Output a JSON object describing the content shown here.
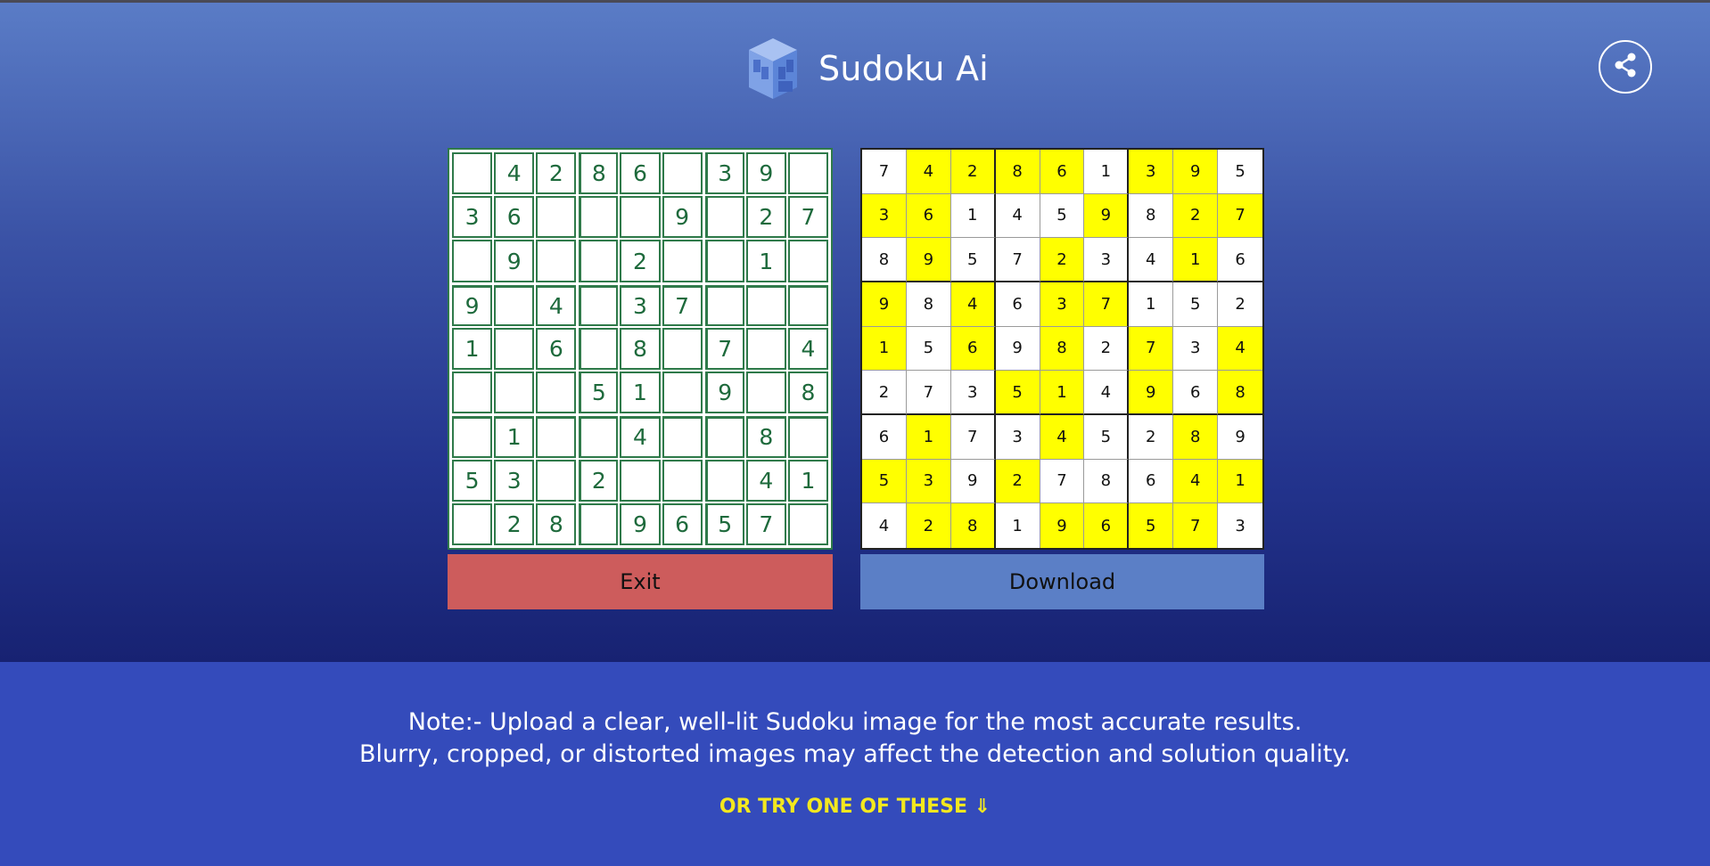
{
  "app": {
    "title": "Sudoku Ai",
    "logo_icon": "cube-logo-icon",
    "share_icon": "share-icon"
  },
  "puzzle": {
    "rows": [
      [
        "",
        "4",
        "2",
        "8",
        "6",
        "",
        "3",
        "9",
        ""
      ],
      [
        "3",
        "6",
        "",
        "",
        "",
        "9",
        "",
        "2",
        "7"
      ],
      [
        "",
        "9",
        "",
        "",
        "2",
        "",
        "",
        "1",
        ""
      ],
      [
        "9",
        "",
        "4",
        "",
        "3",
        "7",
        "",
        "",
        ""
      ],
      [
        "1",
        "",
        "6",
        "",
        "8",
        "",
        "7",
        "",
        "4"
      ],
      [
        "",
        "",
        "",
        "5",
        "1",
        "",
        "9",
        "",
        "8"
      ],
      [
        "",
        "1",
        "",
        "",
        "4",
        "",
        "",
        "8",
        ""
      ],
      [
        "5",
        "3",
        "",
        "2",
        "",
        "",
        "",
        "4",
        "1"
      ],
      [
        "",
        "2",
        "8",
        "",
        "9",
        "6",
        "5",
        "7",
        ""
      ]
    ]
  },
  "solution": {
    "rows": [
      [
        "7",
        "4",
        "2",
        "8",
        "6",
        "1",
        "3",
        "9",
        "5"
      ],
      [
        "3",
        "6",
        "1",
        "4",
        "5",
        "9",
        "8",
        "2",
        "7"
      ],
      [
        "8",
        "9",
        "5",
        "7",
        "2",
        "3",
        "4",
        "1",
        "6"
      ],
      [
        "9",
        "8",
        "4",
        "6",
        "3",
        "7",
        "1",
        "5",
        "2"
      ],
      [
        "1",
        "5",
        "6",
        "9",
        "8",
        "2",
        "7",
        "3",
        "4"
      ],
      [
        "2",
        "7",
        "3",
        "5",
        "1",
        "4",
        "9",
        "6",
        "8"
      ],
      [
        "6",
        "1",
        "7",
        "3",
        "4",
        "5",
        "2",
        "8",
        "9"
      ],
      [
        "5",
        "3",
        "9",
        "2",
        "7",
        "8",
        "6",
        "4",
        "1"
      ],
      [
        "4",
        "2",
        "8",
        "1",
        "9",
        "6",
        "5",
        "7",
        "3"
      ]
    ],
    "highlight_color": "#ffff00"
  },
  "buttons": {
    "exit_label": "Exit",
    "download_label": "Download"
  },
  "footer": {
    "note_line1": "Note:- Upload a clear, well-lit Sudoku image for the most accurate results.",
    "note_line2": "Blurry, cropped, or distorted images may affect the detection and solution quality.",
    "try_label": "OR TRY ONE OF THESE ⇓"
  },
  "colors": {
    "exit": "#cd5c5c",
    "download": "#5b7fc6",
    "footer": "#344bbb",
    "try_link": "#f3e81e",
    "puzzle_ink": "#1e6a3c"
  }
}
